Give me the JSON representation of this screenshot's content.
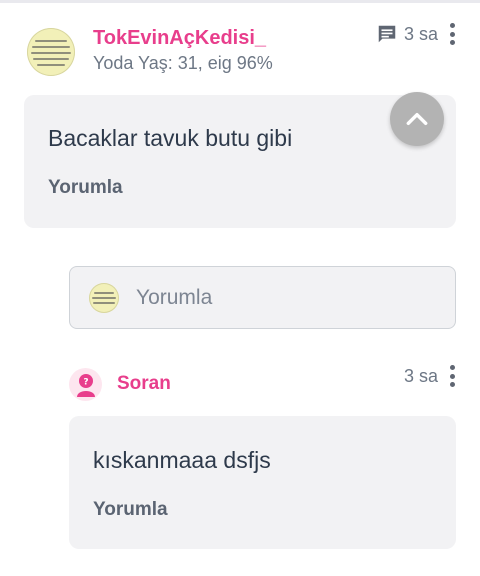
{
  "post": {
    "username": "TokEvinAçKedisi_",
    "meta": "Yoda Yaş: 31, eig 96%",
    "time": "3 sa",
    "text": "Bacaklar tavuk butu gibi",
    "action": "Yorumla"
  },
  "comment_box": {
    "placeholder": "Yorumla"
  },
  "reply": {
    "username": "Soran",
    "time": "3 sa",
    "text": "kıskanmaaa dsfjs",
    "action": "Yorumla"
  },
  "icons": {
    "comment": "chat-bubble-icon",
    "more": "more-vert-icon",
    "scroll_top": "chevron-up-icon",
    "anon_avatar": "anonymous-woman-icon"
  },
  "colors": {
    "accent": "#e83e8c",
    "card_bg": "#f2f2f4",
    "muted": "#6d7785"
  }
}
